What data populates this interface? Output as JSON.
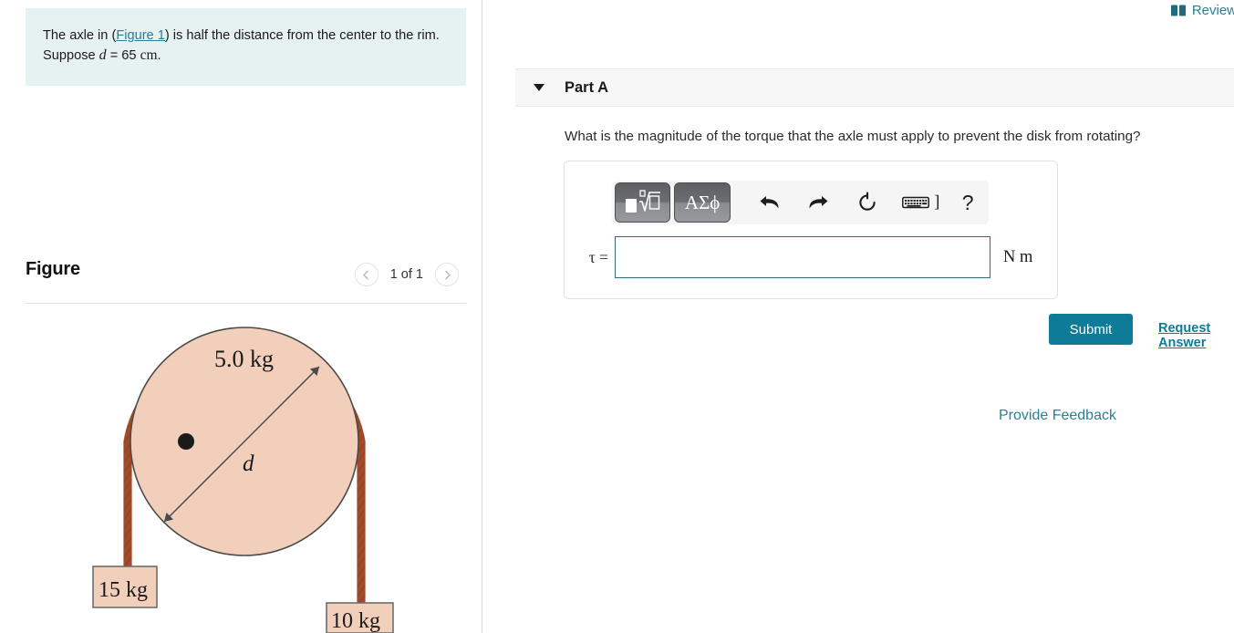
{
  "hint": {
    "text_before_link": "The axle in (",
    "link_label": "Figure 1",
    "text_after_link": ") is half the distance from the center to the rim. Suppose ",
    "variable": "d",
    "equals": " = 65 ",
    "unit": "cm",
    "period": "."
  },
  "figure_panel": {
    "title": "Figure",
    "counter": "1 of 1",
    "prev_icon": "chevron-left-icon",
    "next_icon": "chevron-right-icon"
  },
  "figure_diagram": {
    "disk_label": "5.0 kg",
    "diameter_label": "d",
    "left_mass_label": "15 kg",
    "right_mass_label": "10 kg",
    "disk_fill": "#f2cfba",
    "rope_color": "#b0522f",
    "mass_fill": "#f2cfba"
  },
  "review": {
    "label": "Review",
    "icon": "book-icon"
  },
  "part": {
    "caret_icon": "caret-down-icon",
    "title": "Part A",
    "question": "What is the magnitude of the torque that the axle must apply to prevent the disk from rotating?"
  },
  "answer": {
    "toolbar": {
      "template_button": "√",
      "template_button_name": "math-template-button",
      "greek_button": "ΑΣϕ",
      "undo_icon": "undo-arrow-icon",
      "redo_icon": "redo-arrow-icon",
      "reset_icon": "reset-circular-arrow-icon",
      "keyboard_icon": "keyboard-icon",
      "bracket_label": "]",
      "help_label": "?"
    },
    "prefix_label": "τ =",
    "value": "",
    "placeholder": "",
    "unit": "N m"
  },
  "actions": {
    "submit_label": "Submit",
    "request_answer_label": "Request Answer",
    "provide_feedback_label": "Provide Feedback"
  },
  "colors": {
    "hint_bg": "#e6f2f1",
    "accent_teal": "#0e7c99",
    "link_teal": "#2b7f95",
    "input_border": "#2f6c74",
    "part_header_bg": "#f7f7f7"
  }
}
